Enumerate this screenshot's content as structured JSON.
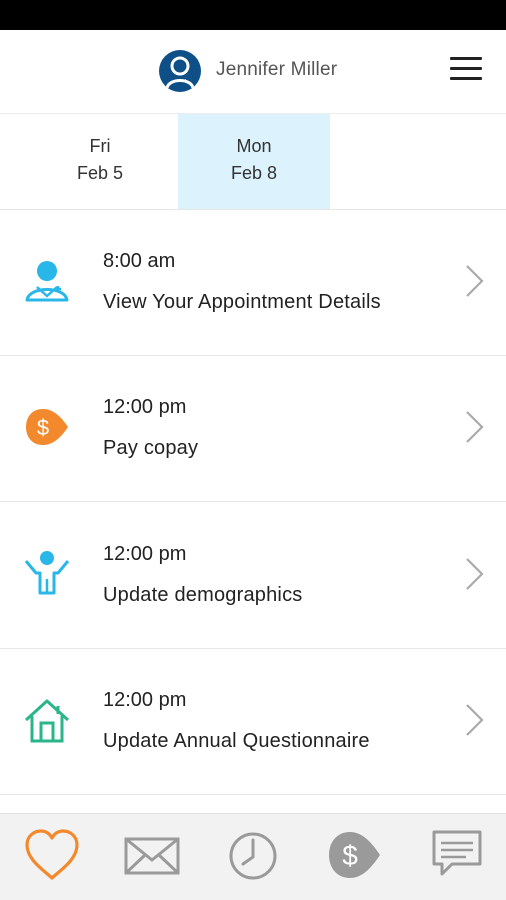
{
  "header": {
    "user_name": "Jennifer Miller"
  },
  "date_tabs": [
    {
      "day": "Fri",
      "date": "Feb 5",
      "active": false
    },
    {
      "day": "Mon",
      "date": "Feb 8",
      "active": true
    }
  ],
  "schedule": [
    {
      "time": "8:00 am",
      "title": "View Your Appointment Details",
      "icon": "doctor-icon"
    },
    {
      "time": "12:00 pm",
      "title": "Pay copay",
      "icon": "dollar-tag-icon"
    },
    {
      "time": "12:00 pm",
      "title": "Update demographics",
      "icon": "person-icon"
    },
    {
      "time": "12:00 pm",
      "title": "Update Annual Questionnaire",
      "icon": "house-icon"
    }
  ],
  "bottom_nav": [
    {
      "icon": "heart-icon",
      "active": true
    },
    {
      "icon": "mail-icon",
      "active": false
    },
    {
      "icon": "clock-icon",
      "active": false
    },
    {
      "icon": "dollar-tag-icon",
      "active": false
    },
    {
      "icon": "chat-icon",
      "active": false
    }
  ],
  "colors": {
    "accent_blue": "#29b6e8",
    "accent_orange": "#f2892c",
    "accent_green": "#2ab58a",
    "header_avatar": "#0d4f86",
    "active_tab_bg": "#dcf3fd",
    "nav_inactive": "#9a9a9a"
  }
}
